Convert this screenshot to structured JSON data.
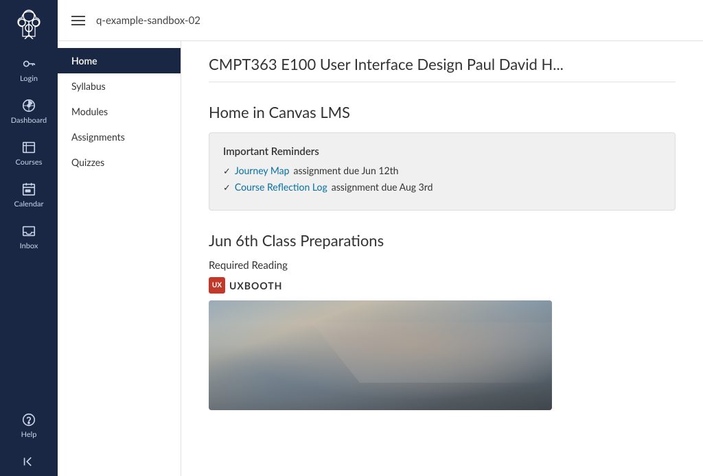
{
  "sidebar": {
    "logo_alt": "Canvas Logo",
    "items": [
      {
        "id": "login",
        "label": "Login",
        "icon": "key-icon"
      },
      {
        "id": "dashboard",
        "label": "Dashboard",
        "icon": "dashboard-icon"
      },
      {
        "id": "courses",
        "label": "Courses",
        "icon": "courses-icon"
      },
      {
        "id": "calendar",
        "label": "Calendar",
        "icon": "calendar-icon"
      },
      {
        "id": "inbox",
        "label": "Inbox",
        "icon": "inbox-icon"
      }
    ],
    "bottom_items": [
      {
        "id": "help",
        "label": "Help",
        "icon": "help-icon"
      },
      {
        "id": "collapse",
        "label": "",
        "icon": "collapse-icon"
      }
    ]
  },
  "topbar": {
    "hamburger_label": "Menu",
    "app_name": "q-example-sandbox-02"
  },
  "course_nav": {
    "items": [
      {
        "id": "home",
        "label": "Home",
        "active": true
      },
      {
        "id": "syllabus",
        "label": "Syllabus",
        "active": false
      },
      {
        "id": "modules",
        "label": "Modules",
        "active": false
      },
      {
        "id": "assignments",
        "label": "Assignments",
        "active": false
      },
      {
        "id": "quizzes",
        "label": "Quizzes",
        "active": false
      }
    ]
  },
  "course": {
    "title": "CMPT363 E100 User Interface Design Paul David H..."
  },
  "home_page": {
    "section_title": "Home in Canvas LMS",
    "reminders": {
      "box_title": "Important Reminders",
      "items": [
        {
          "link_text": "Journey Map",
          "rest_text": " assignment due Jun 12th"
        },
        {
          "link_text": "Course Reflection Log",
          "rest_text": " assignment due Aug 3rd"
        }
      ]
    },
    "prep_section": {
      "title": "Jun 6th Class Preparations",
      "reading_label": "Required Reading",
      "source_name": "UXBOOTH",
      "source_icon_text": "UX"
    }
  }
}
